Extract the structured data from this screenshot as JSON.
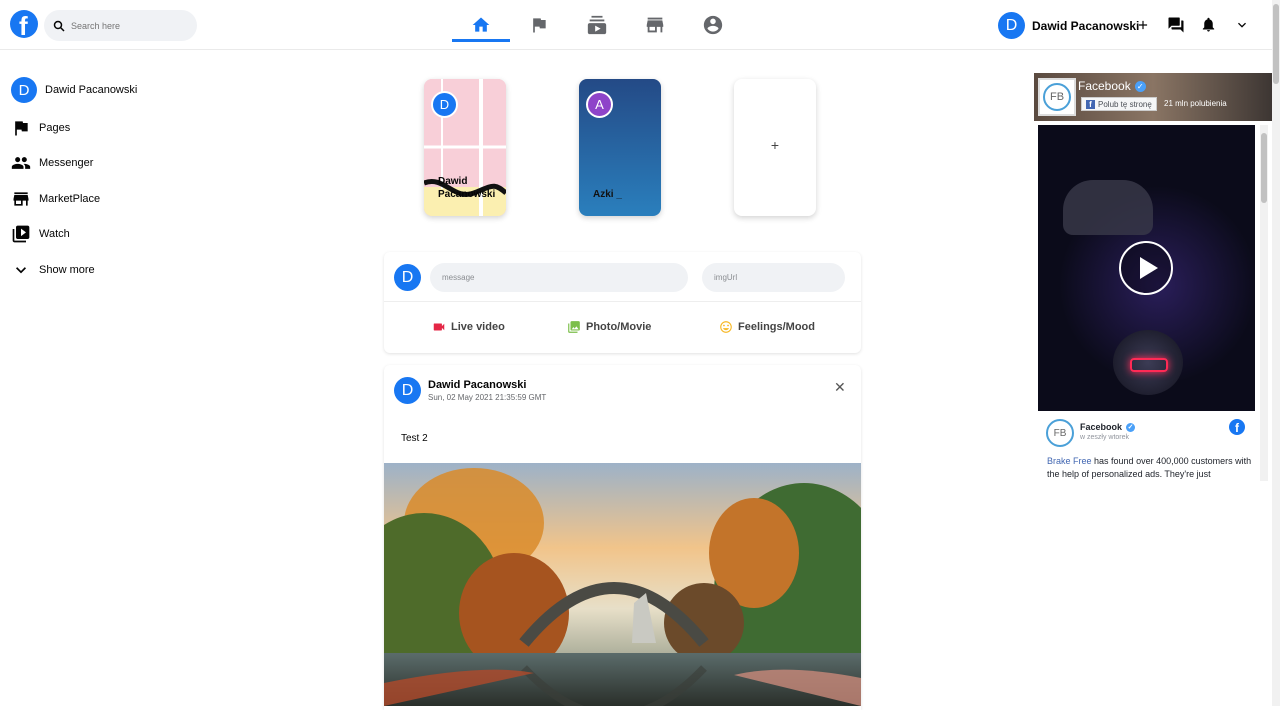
{
  "header": {
    "logo_letter": "f",
    "search_placeholder": "Search here",
    "user_name": "Dawid Pacanowski",
    "user_initial": "D",
    "accent": "#1877f2"
  },
  "nav_tabs": [
    "home-icon",
    "flag-icon",
    "subscriptions-icon",
    "storefront-icon",
    "account-circle-icon"
  ],
  "sidebar": {
    "user_name": "Dawid Pacanowski",
    "user_initial": "D",
    "items": [
      {
        "label": "Pages",
        "icon": "flag-icon"
      },
      {
        "label": "Messenger",
        "icon": "people-icon"
      },
      {
        "label": "MarketPlace",
        "icon": "storefront-icon"
      },
      {
        "label": "Watch",
        "icon": "video-icon"
      },
      {
        "label": "Show more",
        "icon": "chevron-down-icon"
      }
    ]
  },
  "stories": [
    {
      "initial": "D",
      "name": "Dawid Pacanowski",
      "avatar_color": "#1877f2"
    },
    {
      "initial": "A",
      "name": "Azki _",
      "avatar_color": "#8e44c9"
    },
    {
      "add_symbol": "+"
    }
  ],
  "composer": {
    "avatar_initial": "D",
    "message_placeholder": "message",
    "img_placeholder": "imgUrl",
    "buttons": [
      {
        "label": "Live video",
        "icon": "videocam-icon",
        "color": "#e42645"
      },
      {
        "label": "Photo/Movie",
        "icon": "photo-library-icon",
        "color": "#7cbf4b"
      },
      {
        "label": "Feelings/Mood",
        "icon": "emoji-icon",
        "color": "#f7b928"
      }
    ]
  },
  "post": {
    "author": "Dawid Pacanowski",
    "author_initial": "D",
    "timestamp": "Sun, 02 May 2021 21:35:59 GMT",
    "text": "Test 2",
    "close_symbol": "✕"
  },
  "ad": {
    "page_name": "Facebook",
    "logo_text": "FB",
    "like_button": "Polub tę stronę",
    "likes": "21 mln polubienia",
    "post_page": "Facebook",
    "post_time": "w zeszły wtorek",
    "link_text": "Brake Free",
    "body_text": " has found over 400,000 customers with the help of personalized ads. They're just"
  }
}
